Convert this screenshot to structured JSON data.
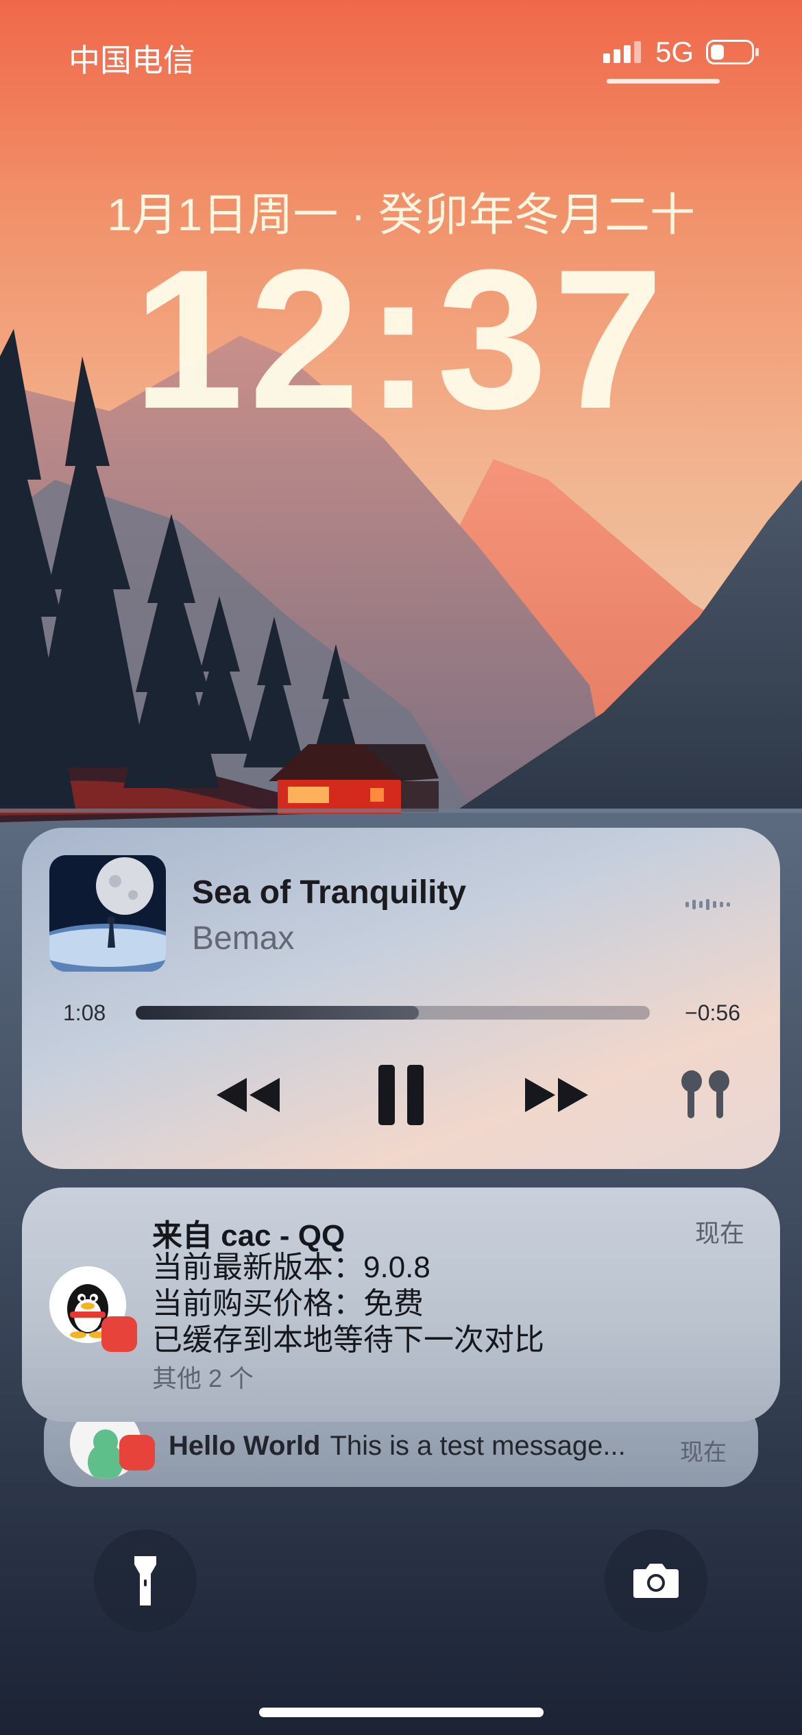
{
  "status_bar": {
    "carrier": "中国电信",
    "network": "5G",
    "signal_icon": "signal-bars-icon",
    "battery_level": 0.35
  },
  "lock_screen": {
    "date": "1月1日周一 · 癸卯年冬月二十",
    "time": "12:37"
  },
  "now_playing": {
    "title": "Sea of Tranquility",
    "artist": "Bemax",
    "elapsed": "1:08",
    "remaining": "−0:56",
    "progress": 0.55,
    "controls": [
      "rewind-icon",
      "pause-icon",
      "fast-forward-icon",
      "airpods-icon"
    ]
  },
  "notification": {
    "title": "来自 cac - QQ",
    "time": "现在",
    "lines": [
      "当前最新版本：9.0.8",
      "当前购买价格：免费",
      "已缓存到本地等待下一次对比"
    ],
    "more": "其他 2 个"
  },
  "notification_stacked": {
    "sender": "Hello World",
    "message": "This is a test message...",
    "time": "现在"
  },
  "bottom_controls": {
    "left": "flashlight-icon",
    "right": "camera-icon"
  },
  "colors": {
    "badge": "#e8433a",
    "sky_top": "#f0684a",
    "cabin": "#d42a1e"
  }
}
